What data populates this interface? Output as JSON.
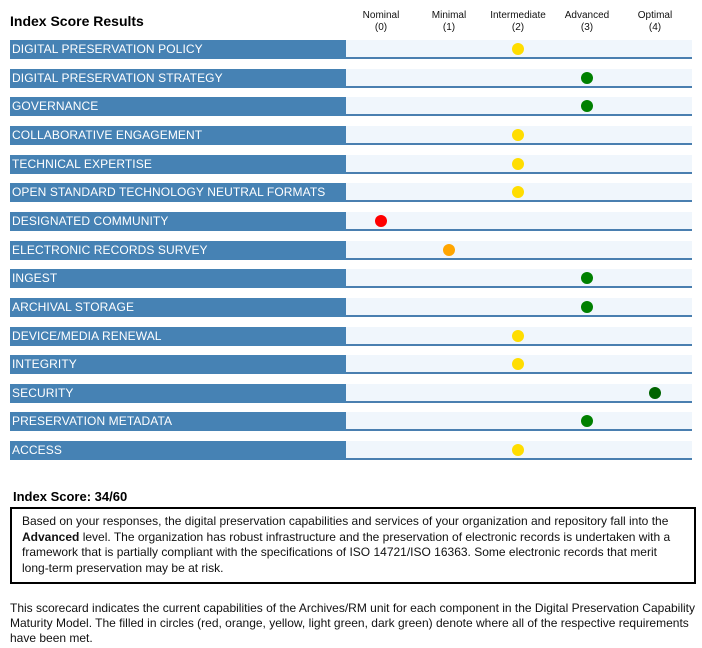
{
  "page": {
    "title": "Index Score Results"
  },
  "levels": [
    {
      "name": "Nominal",
      "value": "(0)",
      "color": "#ff0000"
    },
    {
      "name": "Minimal",
      "value": "(1)",
      "color": "#ffa500"
    },
    {
      "name": "Intermediate",
      "value": "(2)",
      "color": "#ffdd00"
    },
    {
      "name": "Advanced",
      "value": "(3)",
      "color": "#008000"
    },
    {
      "name": "Optimal",
      "value": "(4)",
      "color": "#006400"
    }
  ],
  "components": [
    {
      "label": "DIGITAL PRESERVATION POLICY",
      "score": 2
    },
    {
      "label": "DIGITAL PRESERVATION STRATEGY",
      "score": 3
    },
    {
      "label": "GOVERNANCE",
      "score": 3
    },
    {
      "label": "COLLABORATIVE ENGAGEMENT",
      "score": 2
    },
    {
      "label": "TECHNICAL EXPERTISE",
      "score": 2
    },
    {
      "label": "OPEN STANDARD TECHNOLOGY NEUTRAL FORMATS",
      "score": 2
    },
    {
      "label": "DESIGNATED COMMUNITY",
      "score": 0
    },
    {
      "label": "ELECTRONIC RECORDS SURVEY",
      "score": 1
    },
    {
      "label": "INGEST",
      "score": 3
    },
    {
      "label": "ARCHIVAL STORAGE",
      "score": 3
    },
    {
      "label": "DEVICE/MEDIA RENEWAL",
      "score": 2
    },
    {
      "label": "INTEGRITY",
      "score": 2
    },
    {
      "label": "SECURITY",
      "score": 4
    },
    {
      "label": "PRESERVATION METADATA",
      "score": 3
    },
    {
      "label": "ACCESS",
      "score": 2
    }
  ],
  "index_score": {
    "label": "Index Score: 34/60",
    "value": 34,
    "max": 60
  },
  "summary": {
    "before": "Based on your responses, the digital preservation capabilities and services of your organization and repository fall into the ",
    "level": "Advanced",
    "after": " level. The organization has robust infrastructure and the preservation of electronic records is undertaken with a framework that is partially compliant with the specifications of ISO 14721/ISO 16363. Some electronic records that merit long-term preservation may be at risk."
  },
  "footer": "This scorecard indicates the current capabilities of the Archives/RM unit for each component in the Digital Preservation Capability Maturity Model. The filled in circles (red, orange, yellow, light green, dark green) denote where all of the respective requirements have been met.",
  "chart_data": {
    "type": "table",
    "title": "Index Score Results",
    "columns": [
      "Nominal (0)",
      "Minimal (1)",
      "Intermediate (2)",
      "Advanced (3)",
      "Optimal (4)"
    ],
    "rows": [
      "DIGITAL PRESERVATION POLICY",
      "DIGITAL PRESERVATION STRATEGY",
      "GOVERNANCE",
      "COLLABORATIVE ENGAGEMENT",
      "TECHNICAL EXPERTISE",
      "OPEN STANDARD TECHNOLOGY NEUTRAL FORMATS",
      "DESIGNATED COMMUNITY",
      "ELECTRONIC RECORDS SURVEY",
      "INGEST",
      "ARCHIVAL STORAGE",
      "DEVICE/MEDIA RENEWAL",
      "INTEGRITY",
      "SECURITY",
      "PRESERVATION METADATA",
      "ACCESS"
    ],
    "values": [
      2,
      3,
      3,
      2,
      2,
      2,
      0,
      1,
      3,
      3,
      2,
      2,
      4,
      3,
      2
    ],
    "total": 34,
    "max_total": 60
  }
}
